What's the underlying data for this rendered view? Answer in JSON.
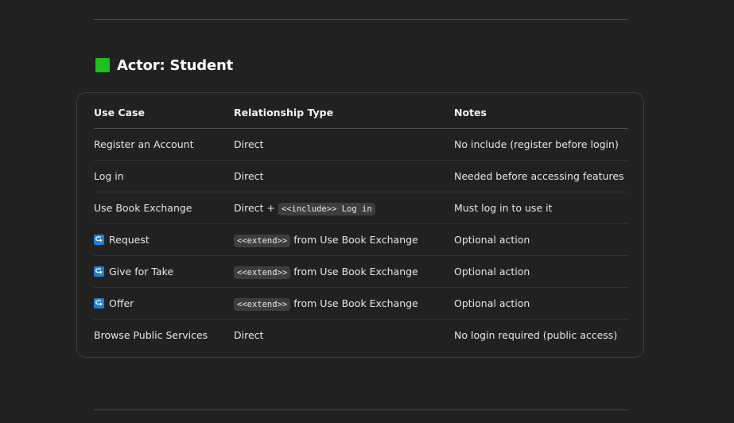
{
  "heading": {
    "title": "Actor: Student",
    "icon": "green-square-icon",
    "icon_color": "#1fbf1f"
  },
  "table": {
    "headers": [
      "Use Case",
      "Relationship Type",
      "Notes"
    ],
    "rows": [
      {
        "use_case": "Register an Account",
        "rel_code": "",
        "rel_text": "Direct",
        "notes": "No include (register before login)"
      },
      {
        "use_case": "Log in",
        "rel_code": "",
        "rel_text": "Direct",
        "notes": "Needed before accessing features"
      },
      {
        "use_case": "Use Book Exchange",
        "rel_prefix": "Direct + ",
        "rel_code": "<<include>> Log in",
        "rel_text": "",
        "notes": "Must log in to use it"
      },
      {
        "use_case": "Request",
        "icon": "return-arrow-icon",
        "rel_code": "<<extend>>",
        "rel_text": " from Use Book Exchange",
        "notes": "Optional action"
      },
      {
        "use_case": "Give for Take",
        "icon": "return-arrow-icon",
        "rel_code": "<<extend>>",
        "rel_text": " from Use Book Exchange",
        "notes": "Optional action"
      },
      {
        "use_case": "Offer",
        "icon": "return-arrow-icon",
        "rel_code": "<<extend>>",
        "rel_text": " from Use Book Exchange",
        "notes": "Optional action"
      },
      {
        "use_case": "Browse Public Services",
        "rel_code": "",
        "rel_text": "Direct",
        "notes": "No login required (public access)"
      }
    ]
  }
}
